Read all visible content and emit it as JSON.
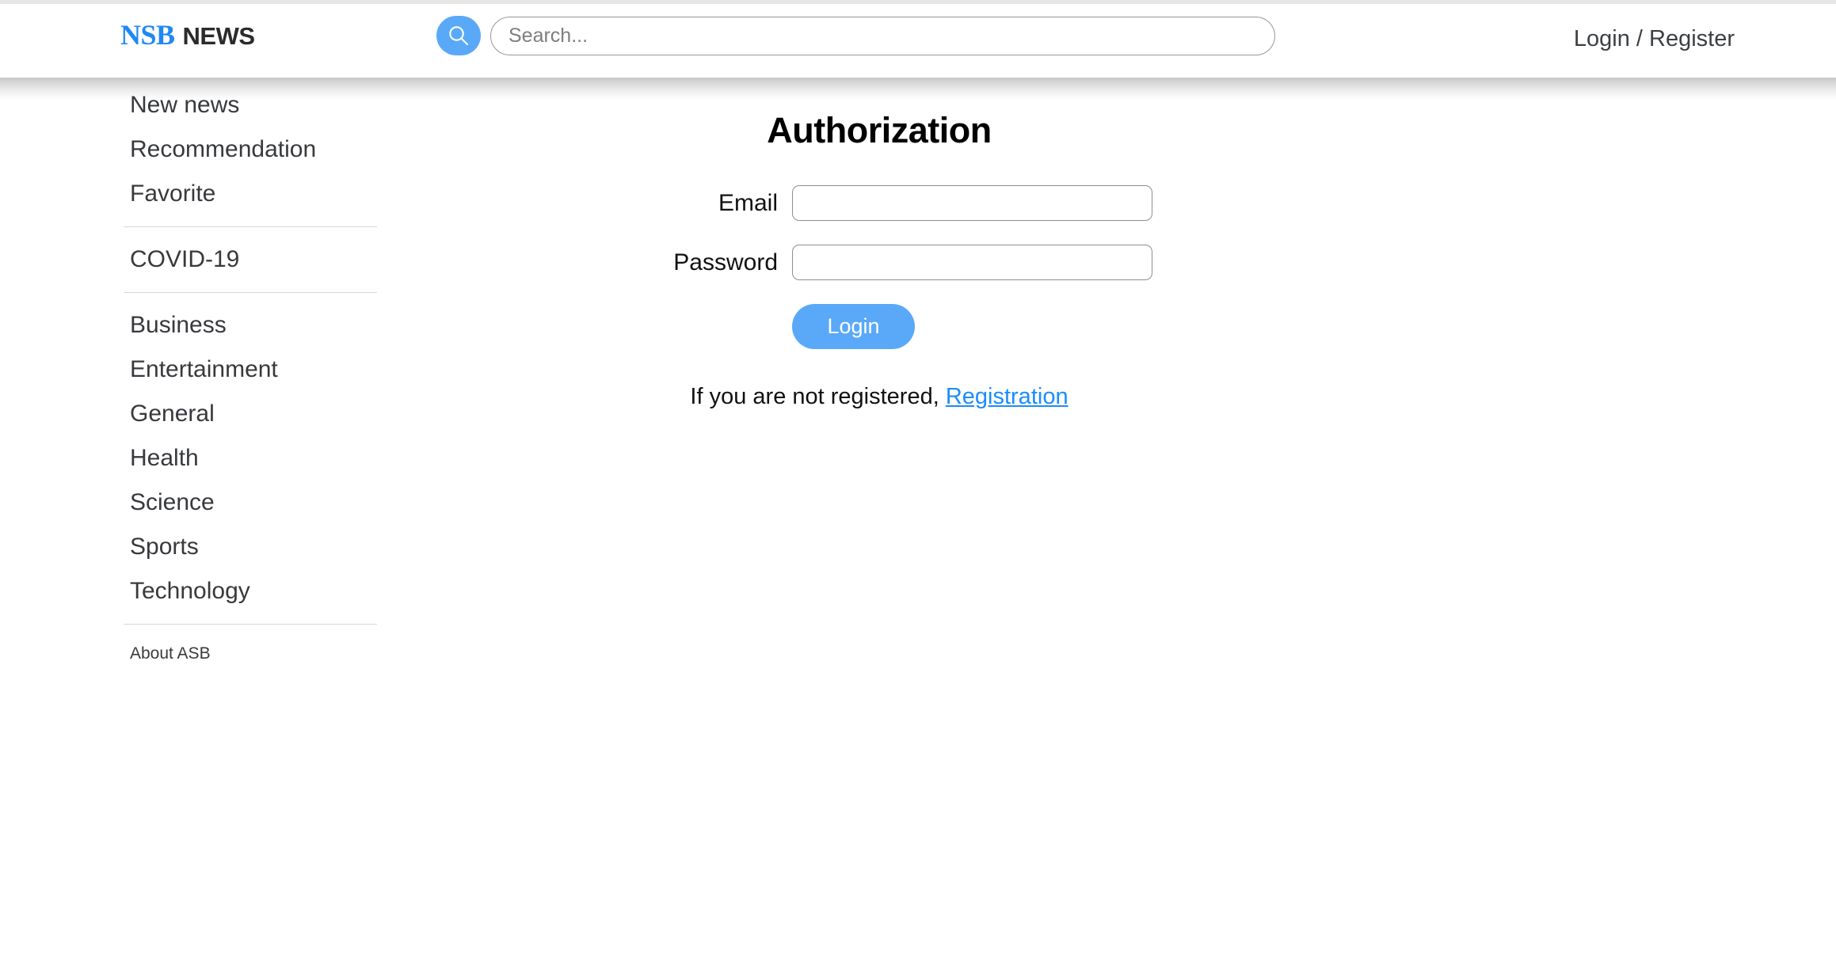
{
  "header": {
    "brand_primary": "NSB",
    "brand_secondary": "NEWS",
    "search": {
      "placeholder": "Search...",
      "value": "",
      "icon": "search-icon",
      "button_color": "#5aa9f8"
    },
    "auth_link_label": "Login / Register"
  },
  "sidebar": {
    "items": [
      {
        "label": "New news",
        "separator_after": false,
        "style": "normal"
      },
      {
        "label": "Recommendation",
        "separator_after": false,
        "style": "normal"
      },
      {
        "label": "Favorite",
        "separator_after": true,
        "style": "normal"
      },
      {
        "label": "COVID-19",
        "separator_after": true,
        "style": "normal"
      },
      {
        "label": "Business",
        "separator_after": false,
        "style": "normal"
      },
      {
        "label": "Entertainment",
        "separator_after": false,
        "style": "normal"
      },
      {
        "label": "General",
        "separator_after": false,
        "style": "normal"
      },
      {
        "label": "Health",
        "separator_after": false,
        "style": "normal"
      },
      {
        "label": "Science",
        "separator_after": false,
        "style": "normal"
      },
      {
        "label": "Sports",
        "separator_after": false,
        "style": "normal"
      },
      {
        "label": "Technology",
        "separator_after": true,
        "style": "normal"
      },
      {
        "label": "About ASB",
        "separator_after": false,
        "style": "small"
      }
    ]
  },
  "main": {
    "title": "Authorization",
    "fields": [
      {
        "label": "Email",
        "value": "",
        "placeholder": "",
        "type": "text"
      },
      {
        "label": "Password",
        "value": "",
        "placeholder": "",
        "type": "password"
      }
    ],
    "login_button_label": "Login",
    "register_note_prefix": "If you are not registered, ",
    "register_link_label": "Registration"
  },
  "colors": {
    "accent_blue": "#5aa9f8",
    "brand_blue": "#1f88f5",
    "link_blue": "#1a8cff",
    "text_dark": "#37393c"
  }
}
